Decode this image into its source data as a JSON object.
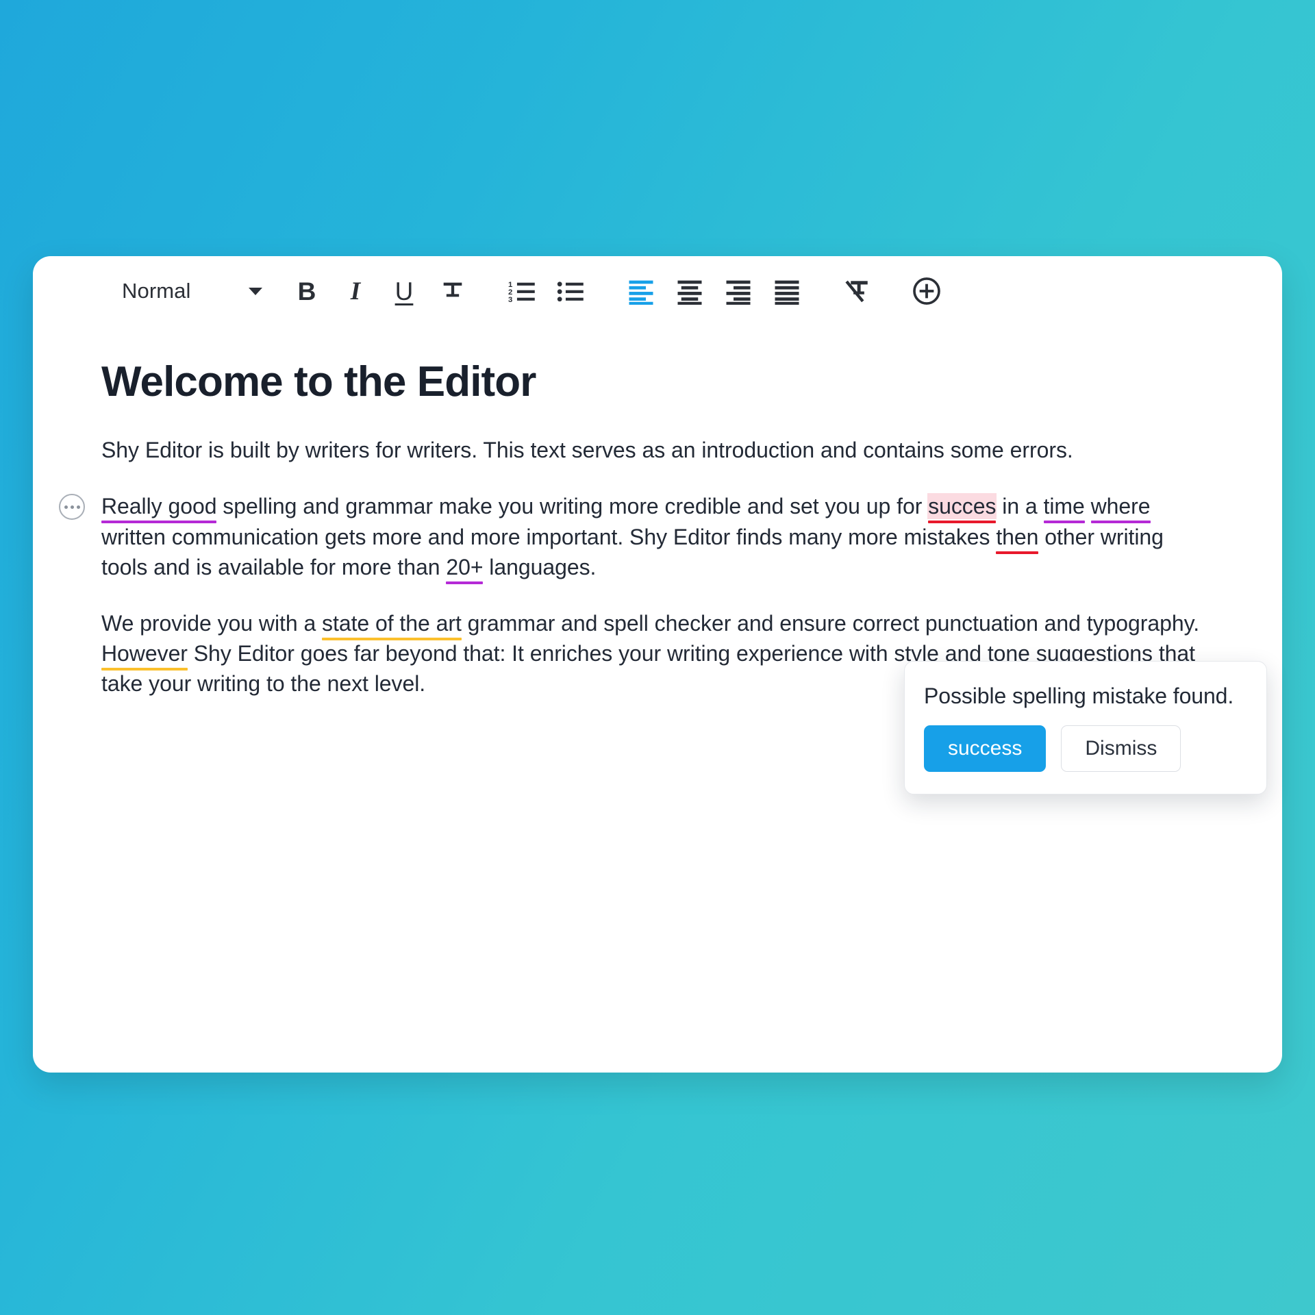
{
  "background": {
    "from": "#1fa8db",
    "to": "#3ec8cd"
  },
  "accent_color": "#17a0e8",
  "toolbar": {
    "style_select": {
      "value": "Normal",
      "caret_icon": "chevron-down-icon"
    },
    "buttons": [
      {
        "name": "bold",
        "label": "B",
        "icon": "bold-icon",
        "active": false
      },
      {
        "name": "italic",
        "label": "I",
        "icon": "italic-icon",
        "active": false
      },
      {
        "name": "underline",
        "label": "U",
        "icon": "underline-icon",
        "active": false
      },
      {
        "name": "strikethrough",
        "label": "T",
        "icon": "strikethrough-icon",
        "active": false
      },
      {
        "name": "ordered-list",
        "label": "",
        "icon": "ordered-list-icon",
        "active": false
      },
      {
        "name": "bullet-list",
        "label": "",
        "icon": "bullet-list-icon",
        "active": false
      },
      {
        "name": "align-left",
        "label": "",
        "icon": "align-left-icon",
        "active": true
      },
      {
        "name": "align-center",
        "label": "",
        "icon": "align-center-icon",
        "active": false
      },
      {
        "name": "align-right",
        "label": "",
        "icon": "align-right-icon",
        "active": false
      },
      {
        "name": "align-justify",
        "label": "",
        "icon": "align-justify-icon",
        "active": false
      },
      {
        "name": "clear-formatting",
        "label": "",
        "icon": "clear-formatting-icon",
        "active": false
      },
      {
        "name": "add-block",
        "label": "",
        "icon": "plus-circle-icon",
        "active": false
      }
    ],
    "ordered_list_markers": [
      "1",
      "2",
      "3"
    ]
  },
  "document": {
    "title": "Welcome to the Editor",
    "paragraphs": [
      {
        "id": "intro",
        "has_gutter_marker": false,
        "segments": [
          {
            "text": "Shy Editor is built by writers for writers. This text serves as an introduction and contains some ",
            "mark": null
          },
          {
            "text": "errors.",
            "mark": null
          }
        ]
      },
      {
        "id": "grammar",
        "has_gutter_marker": true,
        "gutter_icon": "more-dots-icon",
        "segments": [
          {
            "text": "Really good",
            "mark": "purple"
          },
          {
            "text": " spelling and grammar make you writing more credible and set you up for ",
            "mark": null
          },
          {
            "text": "succes",
            "mark": "spell"
          },
          {
            "text": " in a ",
            "mark": null
          },
          {
            "text": "time",
            "mark": "purple"
          },
          {
            "text": " ",
            "mark": null
          },
          {
            "text": "where",
            "mark": "purple"
          },
          {
            "text": " written communication gets more and more important. Shy Editor finds many more mistakes ",
            "mark": null
          },
          {
            "text": "then",
            "mark": "red"
          },
          {
            "text": " other writing tools and is available for more than ",
            "mark": null
          },
          {
            "text": "20+",
            "mark": "purple"
          },
          {
            "text": " languages.",
            "mark": null
          }
        ]
      },
      {
        "id": "features",
        "has_gutter_marker": false,
        "segments": [
          {
            "text": "We provide you with a ",
            "mark": null
          },
          {
            "text": "state of the art",
            "mark": "yellow"
          },
          {
            "text": " grammar and spell checker and ensure correct punctuation and typography. ",
            "mark": null
          },
          {
            "text": "However",
            "mark": "yellow"
          },
          {
            "text": " Shy Editor goes far beyond that: It enriches your writing experience with style and tone suggestions that take your writing to the next level.",
            "mark": null
          }
        ]
      }
    ]
  },
  "spell_popup": {
    "message": "Possible spelling mistake found.",
    "primary_button": "success",
    "secondary_button": "Dismiss"
  },
  "mark_colors": {
    "purple": "#b52ad6",
    "red": "#e8192c",
    "yellow": "#fbc02d",
    "spell_highlight": "#fbdbe1"
  }
}
